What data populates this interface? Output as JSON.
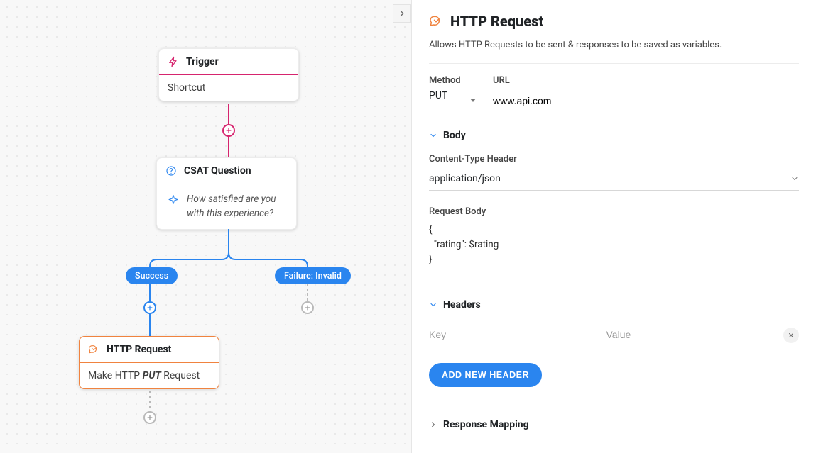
{
  "panel_title": "HTTP Request",
  "panel_desc": "Allows HTTP Requests to be sent & responses to be saved as variables.",
  "method_label": "Method",
  "method_value": "PUT",
  "url_label": "URL",
  "url_value": "www.api.com",
  "body_section_label": "Body",
  "content_type_label": "Content-Type Header",
  "content_type_value": "application/json",
  "request_body_label": "Request Body",
  "request_body_value": "{\n  \"rating\": $rating\n}",
  "headers_section_label": "Headers",
  "header_key_placeholder": "Key",
  "header_value_placeholder": "Value",
  "add_header_btn": "ADD NEW HEADER",
  "response_mapping_label": "Response Mapping",
  "flow": {
    "trigger": {
      "title": "Trigger",
      "body": "Shortcut"
    },
    "csat": {
      "title": "CSAT Question",
      "question": "How satisfied are you with this experience?"
    },
    "branches": {
      "success": "Success",
      "failure": "Failure: Invalid"
    },
    "http": {
      "title": "HTTP Request",
      "body_prefix": "Make HTTP ",
      "body_method": "PUT",
      "body_suffix": " Request"
    }
  }
}
